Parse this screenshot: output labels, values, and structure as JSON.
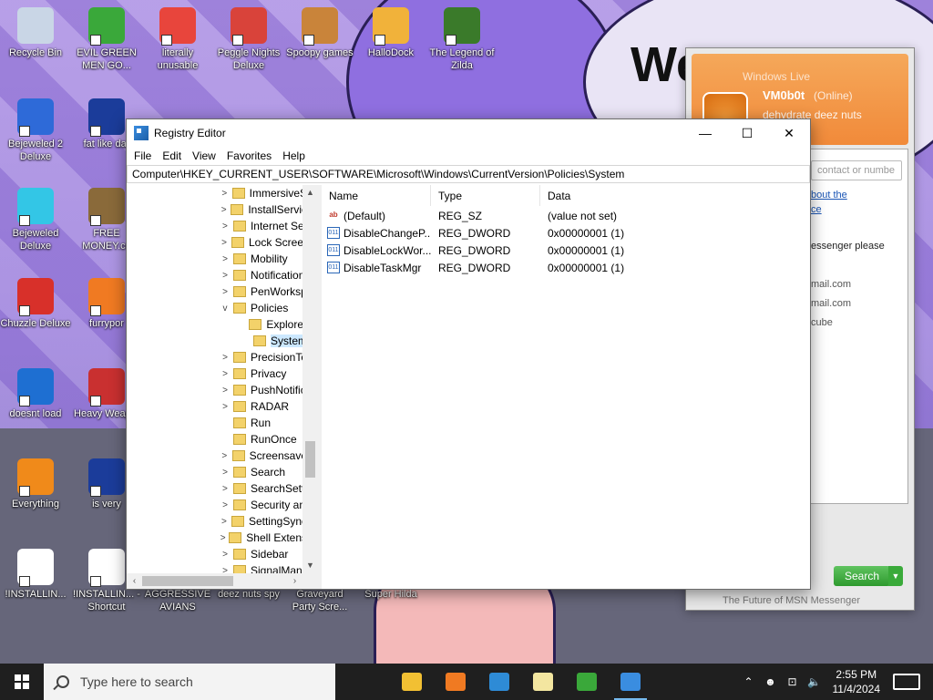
{
  "desktop": {
    "welcome_text": "We",
    "icons": [
      {
        "label": "Recycle Bin",
        "color": "#c9d6e6"
      },
      {
        "label": "EVIL GREEN MEN GO...",
        "color": "#3aa83a"
      },
      {
        "label": "literally unusable",
        "color": "#e8453c"
      },
      {
        "label": "Peggle Nights Deluxe",
        "color": "#d9433a"
      },
      {
        "label": "Spoopy games",
        "color": "#c9843a"
      },
      {
        "label": "HalloDock",
        "color": "#f1b23a"
      },
      {
        "label": "The Legend of Zilda",
        "color": "#3a7a2a"
      },
      {
        "label": "Bejeweled 2 Deluxe",
        "color": "#2e6ad8"
      },
      {
        "label": "fat like dar",
        "color": "#1b3c9a"
      },
      {
        "label": "Bejeweled Deluxe",
        "color": "#33c6e6"
      },
      {
        "label": "FREE MONEY.co",
        "color": "#8a6a3a"
      },
      {
        "label": "Chuzzle Deluxe",
        "color": "#d8302a"
      },
      {
        "label": "furrypor",
        "color": "#f07a22"
      },
      {
        "label": "doesnt load",
        "color": "#1e6fd2"
      },
      {
        "label": "Heavy Weap...",
        "color": "#c93030"
      },
      {
        "label": "Everything",
        "color": "#f08a1a"
      },
      {
        "label": "is very",
        "color": "#1b3c9a"
      },
      {
        "label": "!INSTALLIN...",
        "color": "#ffffff"
      },
      {
        "label": "!INSTALLIN... - Shortcut",
        "color": "#ffffff"
      },
      {
        "label": "AGGRESSIVE AVIANS",
        "color": "#7a7a7a"
      },
      {
        "label": "deez nuts spy",
        "color": "#7a7a7a"
      },
      {
        "label": "Graveyard Party Scre...",
        "color": "#7a7a7a"
      },
      {
        "label": "Super Hilda",
        "color": "#7a7a7a"
      }
    ]
  },
  "regedit": {
    "title": "Registry Editor",
    "window_controls": [
      "—",
      "☐",
      "✕"
    ],
    "menu": [
      "File",
      "Edit",
      "View",
      "Favorites",
      "Help"
    ],
    "address": "Computer\\HKEY_CURRENT_USER\\SOFTWARE\\Microsoft\\Windows\\CurrentVersion\\Policies\\System",
    "tree": [
      {
        "label": "ImmersiveS",
        "expand": ">",
        "level": 0
      },
      {
        "label": "InstallServic",
        "expand": ">",
        "level": 0
      },
      {
        "label": "Internet Set",
        "expand": ">",
        "level": 0
      },
      {
        "label": "Lock Screer",
        "expand": ">",
        "level": 0
      },
      {
        "label": "Mobility",
        "expand": ">",
        "level": 0
      },
      {
        "label": "Notification",
        "expand": ">",
        "level": 0
      },
      {
        "label": "PenWorksp",
        "expand": ">",
        "level": 0
      },
      {
        "label": "Policies",
        "expand": "v",
        "level": 0
      },
      {
        "label": "Explorer",
        "expand": "",
        "level": 1
      },
      {
        "label": "System",
        "expand": "",
        "level": 1,
        "selected": true
      },
      {
        "label": "PrecisionTo",
        "expand": ">",
        "level": 0
      },
      {
        "label": "Privacy",
        "expand": ">",
        "level": 0
      },
      {
        "label": "PushNotific",
        "expand": ">",
        "level": 0
      },
      {
        "label": "RADAR",
        "expand": ">",
        "level": 0
      },
      {
        "label": "Run",
        "expand": "",
        "level": 0
      },
      {
        "label": "RunOnce",
        "expand": "",
        "level": 0
      },
      {
        "label": "Screensave",
        "expand": ">",
        "level": 0
      },
      {
        "label": "Search",
        "expand": ">",
        "level": 0
      },
      {
        "label": "SearchSetti",
        "expand": ">",
        "level": 0
      },
      {
        "label": "Security an",
        "expand": ">",
        "level": 0
      },
      {
        "label": "SettingSync",
        "expand": ">",
        "level": 0
      },
      {
        "label": "Shell Extens",
        "expand": ">",
        "level": 0
      },
      {
        "label": "Sidebar",
        "expand": ">",
        "level": 0
      },
      {
        "label": "SignalMan",
        "expand": ">",
        "level": 0
      }
    ],
    "columns": [
      "Name",
      "Type",
      "Data"
    ],
    "values": [
      {
        "name": "(Default)",
        "type": "REG_SZ",
        "data": "(value not set)",
        "icon": "ab"
      },
      {
        "name": "DisableChangeP...",
        "type": "REG_DWORD",
        "data": "0x00000001 (1)",
        "icon": "011"
      },
      {
        "name": "DisableLockWor...",
        "type": "REG_DWORD",
        "data": "0x00000001 (1)",
        "icon": "011"
      },
      {
        "name": "DisableTaskMgr",
        "type": "REG_DWORD",
        "data": "0x00000001 (1)",
        "icon": "011"
      }
    ]
  },
  "messenger": {
    "title": "Windows Live",
    "user": "VM0b0t",
    "status": "(Online)",
    "message": "dehydrate deez nuts",
    "search_placeholder": "contact or numbe",
    "link1": "bout the",
    "link2": "ce",
    "text1": "essenger please",
    "mail1": "mail.com",
    "mail2": "mail.com",
    "text2": "cube",
    "search_button": "Search",
    "footer": "The Future of MSN Messenger"
  },
  "taskbar": {
    "search_placeholder": "Type here to search",
    "apps": [
      "file-explorer",
      "firefox",
      "app-3",
      "notepad",
      "msn",
      "regedit"
    ],
    "time": "2:55 PM",
    "date": "11/4/2024"
  }
}
